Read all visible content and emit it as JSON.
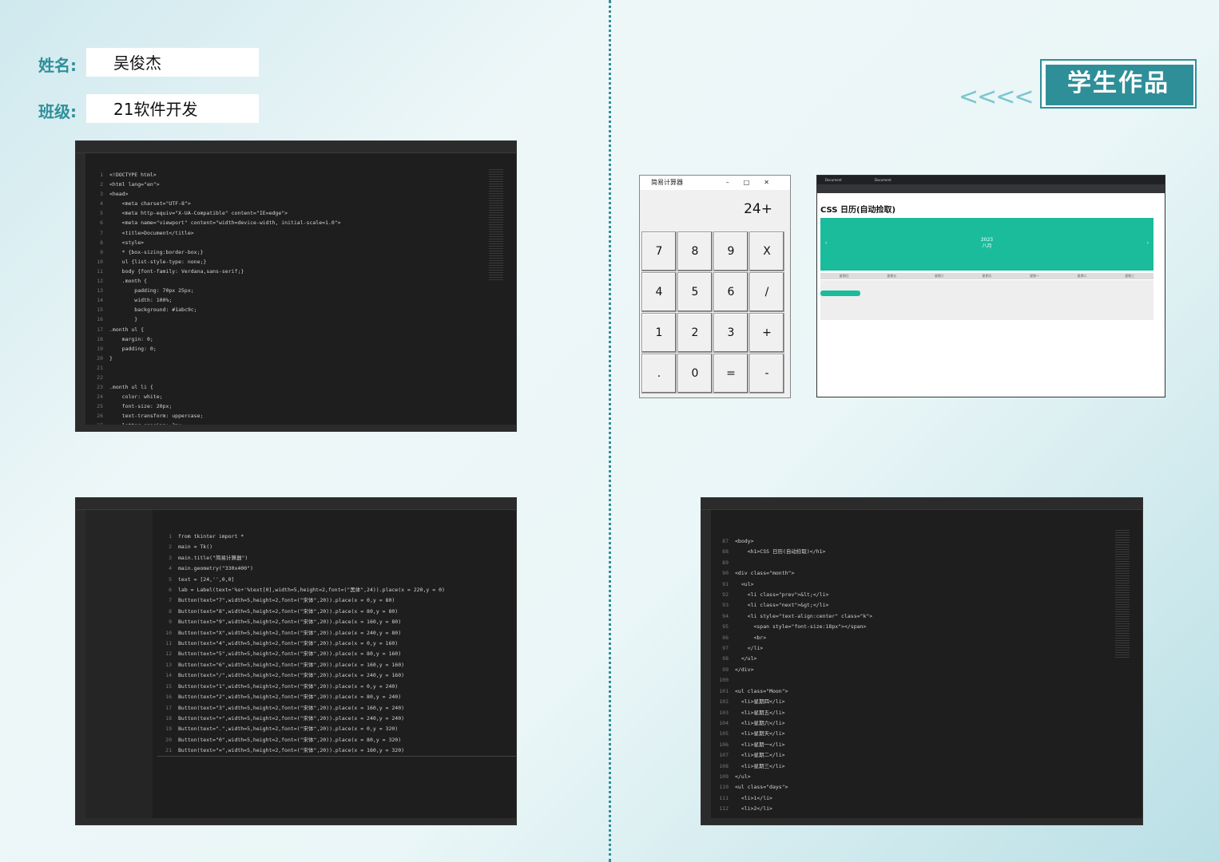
{
  "student": {
    "name_label": "姓名:",
    "name_value": "吴俊杰",
    "class_label": "班级:",
    "class_value": "21软件开发"
  },
  "banner": {
    "title": "学生作品",
    "arrows": "<<<<"
  },
  "shot1": {
    "lines": [
      "<!DOCTYPE html>",
      "<html lang=\"en\">",
      "<head>",
      "    <meta charset=\"UTF-8\">",
      "    <meta http-equiv=\"X-UA-Compatible\" content=\"IE=edge\">",
      "    <meta name=\"viewport\" content=\"width=device-width, initial-scale=1.0\">",
      "    <title>Document</title>",
      "    <style>",
      "    * {box-sizing:border-box;}",
      "    ul {list-style-type: none;}",
      "    body {font-family: Verdana,sans-serif;}",
      "    .month {",
      "        padding: 70px 25px;",
      "        width: 100%;",
      "        background: #1abc9c;",
      "        }",
      ".month ul {",
      "    margin: 0;",
      "    padding: 0;",
      "}",
      "",
      "",
      ".month ul li {",
      "    color: white;",
      "    font-size: 20px;",
      "    text-transform: uppercase;",
      "    letter-spacing: 3px;",
      "}"
    ]
  },
  "calculator": {
    "title": "简易计算器",
    "display": "24+",
    "buttons": [
      "7",
      "8",
      "9",
      "X",
      "4",
      "5",
      "6",
      "/",
      "1",
      "2",
      "3",
      "+",
      ".",
      "0",
      "=",
      "-"
    ]
  },
  "browser": {
    "tab1": "Document",
    "tab2": "Document",
    "heading": "CSS 日历(自动捡取)",
    "year": "2023",
    "month": "八月",
    "weekdays": [
      "星期日",
      "星期五",
      "星期六",
      "星期天",
      "星期一",
      "星期二",
      "星期三"
    ]
  },
  "shot3": {
    "lines": [
      "from tkinter import *",
      "main = Tk()",
      "main.title(\"简易计算器\")",
      "main.geometry(\"330x400\")",
      "text = [24,'',0,0]",
      "lab = Label(text='%s+'%text[0],width=5,height=2,font=(\"黑体\",24)).place(x = 220,y = 0)",
      "Button(text=\"7\",width=5,height=2,font=(\"宋体\",20)).place(x = 0,y = 80)",
      "Button(text=\"8\",width=5,height=2,font=(\"宋体\",20)).place(x = 80,y = 80)",
      "Button(text=\"9\",width=5,height=2,font=(\"宋体\",20)).place(x = 160,y = 80)",
      "Button(text=\"X\",width=5,height=2,font=(\"宋体\",20)).place(x = 240,y = 80)",
      "Button(text=\"4\",width=5,height=2,font=(\"宋体\",20)).place(x = 0,y = 160)",
      "Button(text=\"5\",width=5,height=2,font=(\"宋体\",20)).place(x = 80,y = 160)",
      "Button(text=\"6\",width=5,height=2,font=(\"宋体\",20)).place(x = 160,y = 160)",
      "Button(text=\"/\",width=5,height=2,font=(\"宋体\",20)).place(x = 240,y = 160)",
      "Button(text=\"1\",width=5,height=2,font=(\"宋体\",20)).place(x = 0,y = 240)",
      "Button(text=\"2\",width=5,height=2,font=(\"宋体\",20)).place(x = 80,y = 240)",
      "Button(text=\"3\",width=5,height=2,font=(\"宋体\",20)).place(x = 160,y = 240)",
      "Button(text=\"+\",width=5,height=2,font=(\"宋体\",20)).place(x = 240,y = 240)",
      "Button(text=\".\",width=5,height=2,font=(\"宋体\",20)).place(x = 0,y = 320)",
      "Button(text=\"0\",width=5,height=2,font=(\"宋体\",20)).place(x = 80,y = 320)",
      "Button(text=\"=\",width=5,height=2,font=(\"宋体\",20)).place(x = 160,y = 320)"
    ]
  },
  "shot4": {
    "start": 87,
    "lines": [
      "<body>",
      "    <h1>CSS 日历(自动捡取)</h1>",
      "",
      "<div class=\"month\">",
      "  <ul>",
      "    <li class=\"prev\">&lt;</li>",
      "    <li class=\"next\">&gt;</li>",
      "    <li style=\"text-align:center\" class=\"k\">",
      "      <span style=\"font-size:18px\"></span>",
      "      <br>",
      "    </li>",
      "  </ul>",
      "</div>",
      "",
      "<ul class=\"Moon\">",
      "  <li>星期四</li>",
      "  <li>星期五</li>",
      "  <li>星期六</li>",
      "  <li>星期天</li>",
      "  <li>星期一</li>",
      "  <li>星期二</li>",
      "  <li>星期三</li>",
      "</ul>",
      "<ul class=\"days\">",
      "  <li>1</li>",
      "  <li>2</li>"
    ]
  }
}
